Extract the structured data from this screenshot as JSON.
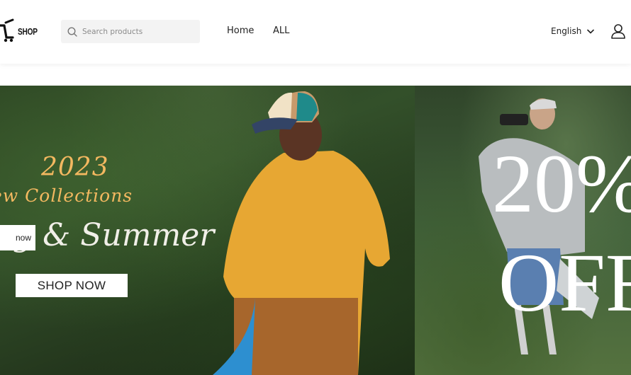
{
  "brand": {
    "logo_text": "SHOP"
  },
  "search": {
    "placeholder": "Search products",
    "icon": "search-icon"
  },
  "nav": {
    "items": [
      {
        "label": "Home"
      },
      {
        "label": "ALL"
      }
    ]
  },
  "language": {
    "selected": "English"
  },
  "account": {
    "icon": "user-icon"
  },
  "hero": {
    "year": "2023",
    "collections": "ew Collections",
    "season": "g & Summer",
    "pill_label": "now",
    "shop_button": "SHOP NOW",
    "promo_line1": "20%",
    "promo_line2": "OFF"
  },
  "colors": {
    "accent_gold": "#f3b860",
    "search_bg": "#f3f3f3"
  }
}
